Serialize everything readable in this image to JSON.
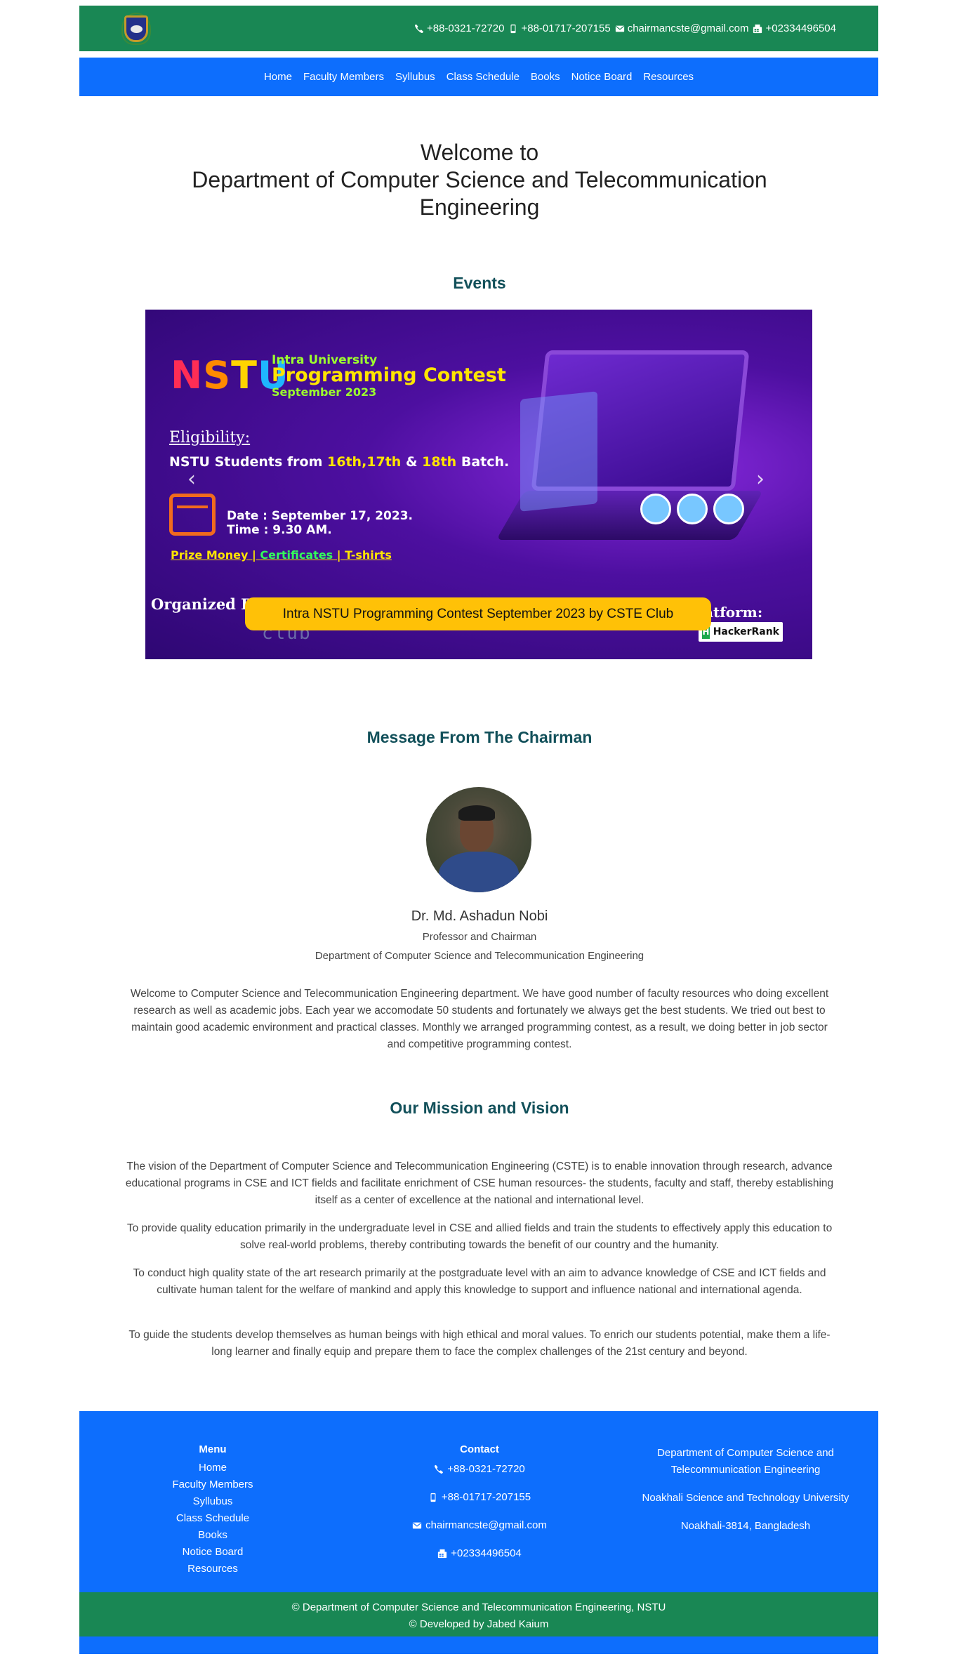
{
  "topbar": {
    "phone1": "+88-0321-72720",
    "mobile": "+88-01717-207155",
    "email": "chairmancste@gmail.com",
    "fax": "+02334496504"
  },
  "nav": {
    "items": [
      "Home",
      "Faculty Members",
      "Syllubus",
      "Class Schedule",
      "Books",
      "Notice Board",
      "Resources"
    ]
  },
  "welcome": {
    "line1": "Welcome to",
    "line2": "Department of Computer Science and Telecommunication",
    "line3": "Engineering"
  },
  "events": {
    "title": "Events",
    "slide": {
      "intra": "Intra University",
      "programming": "Programming Contest",
      "month": "September 2023",
      "eligibility": "Eligibility:",
      "students_prefix": "NSTU Students from ",
      "batches": "16th,17th",
      "amp": " & ",
      "batch3": "18th",
      "batch_suffix": " Batch.",
      "date": "Date  : September 17, 2023.",
      "time": "Time  : 9.30 AM.",
      "prize": "Prize Money",
      "sep": " | ",
      "certificates": "Certificates",
      "tshirts": "T-shirts",
      "organized": "Organized By",
      "club": "club",
      "platform": "atform:",
      "hackerrank": "HackerRank",
      "caption": "Intra NSTU Programming Contest September 2023 by CSTE Club"
    },
    "prev_icon": "chevron-left-icon",
    "next_icon": "chevron-right-icon"
  },
  "chairman": {
    "title": "Message From The Chairman",
    "name": "Dr. Md. Ashadun Nobi",
    "role": "Professor and Chairman",
    "dept": "Department of Computer Science and Telecommunication Engineering",
    "message": "Welcome to Computer Science and Telecommunication Engineering department. We have good number of faculty resources who doing excellent research as well as academic jobs. Each year we accomodate 50 students and fortunately we always get the best students. We tried out best to maintain good academic environment and practical classes. Monthly we arranged programming contest, as a result, we doing better in job sector and competitive programming contest."
  },
  "mission": {
    "title": "Our Mission and Vision",
    "paragraphs": [
      "The vision of the Department of Computer Science and Telecommunication Engineering (CSTE) is to enable innovation through research, advance educational programs in CSE and ICT fields and facilitate enrichment of CSE human resources- the students, faculty and staff, thereby establishing itself as a center of excellence at the national and international level.",
      "To provide quality education primarily in the undergraduate level in CSE and allied fields and train the students to effectively apply this education to solve real-world problems, thereby contributing towards the benefit of our country and the humanity.",
      "To conduct high quality state of the art research primarily at the postgraduate level with an aim to advance knowledge of CSE and ICT fields and cultivate human talent for the welfare of mankind and apply this knowledge to support and influence national and international agenda.",
      "To guide the students develop themselves as human beings with high ethical and moral values. To enrich our students potential, make them a life-long learner and finally equip and prepare them to face the complex challenges of the 21st century and beyond."
    ]
  },
  "footer": {
    "menu_title": "Menu",
    "menu": [
      "Home",
      "Faculty Members",
      "Syllubus",
      "Class Schedule",
      "Books",
      "Notice Board",
      "Resources"
    ],
    "contact_title": "Contact",
    "contact_phone": "+88-0321-72720",
    "contact_mobile": "+88-01717-207155",
    "contact_email": "chairmancste@gmail.com",
    "contact_fax": "+02334496504",
    "address_line1": "Department of Computer Science and",
    "address_line2": "Telecommunication Engineering",
    "address_university": "Noakhali Science and Technology University",
    "address_city": "Noakhali-3814, Bangladesh",
    "copyright": "© Department of Computer Science and Telecommunication Engineering, NSTU",
    "developer": "© Developed by Jabed Kaium"
  },
  "colors": {
    "green": "#198754",
    "blue": "#0d6efd",
    "caption_yellow": "#ffc107",
    "heading_teal": "#12505a"
  }
}
